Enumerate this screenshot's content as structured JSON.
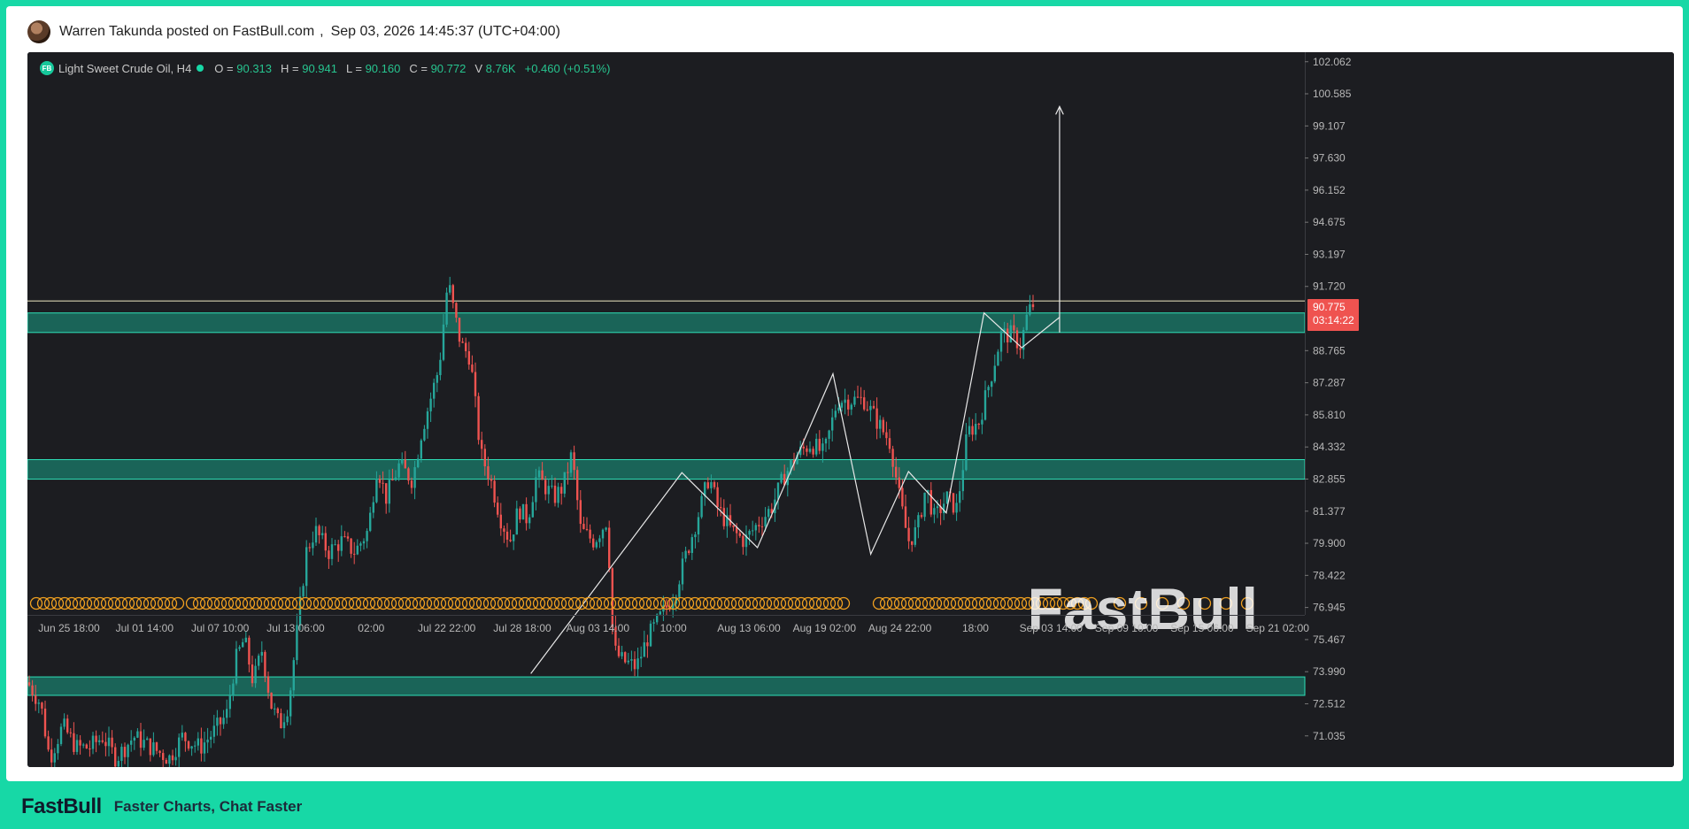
{
  "post": {
    "author": "Warren Takunda",
    "text": "Warren Takunda posted on FastBull.com",
    "separator": ",",
    "timestamp": "Sep 03, 2026 14:45:37 (UTC+04:00)"
  },
  "legend": {
    "badge": "FB",
    "symbol": "Light Sweet Crude Oil, H4",
    "o_label": "O =",
    "o_value": "90.313",
    "h_label": "H =",
    "h_value": "90.941",
    "l_label": "L =",
    "l_value": "90.160",
    "c_label": "C =",
    "c_value": "90.772",
    "v_label": "V",
    "v_value": "8.76K",
    "change": "+0.460 (+0.51%)"
  },
  "price_tag": {
    "price": "90.775",
    "countdown": "03:14:22"
  },
  "watermark": "FastBull",
  "footer": {
    "logo": "FastBull",
    "tagline": "Faster Charts, Chat Faster"
  },
  "colors": {
    "up": "#26a69a",
    "down": "#ef5350",
    "zone": "#1a8f7a",
    "accent": "#17d8a6",
    "price_tag": "#ef5350",
    "marker": "#f0a020"
  },
  "chart_data": {
    "type": "candlestick",
    "title": "Light Sweet Crude Oil, H4",
    "ylim": [
      69.6,
      102.5
    ],
    "y_ticks": [
      "102.062",
      "100.585",
      "99.107",
      "97.630",
      "96.152",
      "94.675",
      "93.197",
      "91.720",
      "88.765",
      "87.287",
      "85.810",
      "84.332",
      "82.855",
      "81.377",
      "79.900",
      "78.422",
      "76.945",
      "75.467",
      "73.990",
      "72.512",
      "71.035"
    ],
    "x_ticks": [
      "Jun 25 18:00",
      "Jul 01 14:00",
      "Jul 07 10:00",
      "Jul 13 06:00",
      "02:00",
      "Jul 22 22:00",
      "Jul 28 18:00",
      "Aug 03 14:00",
      "10:00",
      "Aug 13 06:00",
      "Aug 19 02:00",
      "Aug 24 22:00",
      "18:00",
      "Sep 03 14:00",
      "Sep 09 10:00",
      "Sep 15 06:00",
      "Sep 21 02:00"
    ],
    "zones": [
      [
        89.6,
        90.5
      ],
      [
        82.85,
        83.75
      ],
      [
        72.9,
        73.75
      ]
    ],
    "horizontal_line": 91.05,
    "path_points": [
      [
        "Jul 28 18:00+",
        73.9
      ],
      [
        "Aug 13 06:00-",
        83.15
      ],
      [
        "Aug 13 06:00+",
        79.7
      ],
      [
        "Aug 19 02:00+",
        87.7
      ],
      [
        "Aug 24 22:00",
        79.4
      ],
      [
        "Aug 24 22:00+",
        83.2
      ],
      [
        "18:00",
        81.3
      ],
      [
        "18:00+",
        90.5
      ],
      [
        "Sep 03 14:00",
        88.9
      ],
      [
        "Sep 03 14:00+",
        90.3
      ]
    ],
    "projection": [
      [
        "Sep 03 14:00+",
        89.6
      ],
      [
        "Sep 09 10:00-",
        100.0
      ]
    ],
    "price_path": [
      [
        0,
        73.5
      ],
      [
        15,
        72.5
      ],
      [
        25,
        70.0
      ],
      [
        40,
        71.5
      ],
      [
        55,
        70.5
      ],
      [
        70,
        70.5
      ],
      [
        85,
        71.0
      ],
      [
        100,
        70.0
      ],
      [
        120,
        71.0
      ],
      [
        140,
        70.5
      ],
      [
        160,
        70.0
      ],
      [
        175,
        71.0
      ],
      [
        195,
        70.5
      ],
      [
        210,
        71.2
      ],
      [
        225,
        72.0
      ],
      [
        235,
        74.5
      ],
      [
        245,
        75.5
      ],
      [
        255,
        73.5
      ],
      [
        265,
        75.0
      ],
      [
        275,
        72.5
      ],
      [
        285,
        71.5
      ],
      [
        295,
        72.5
      ],
      [
        305,
        76.0
      ],
      [
        315,
        79.5
      ],
      [
        325,
        80.5
      ],
      [
        340,
        79.5
      ],
      [
        355,
        80.0
      ],
      [
        370,
        79.5
      ],
      [
        385,
        80.5
      ],
      [
        395,
        83.5
      ],
      [
        405,
        82.0
      ],
      [
        420,
        83.5
      ],
      [
        435,
        82.8
      ],
      [
        445,
        85.0
      ],
      [
        455,
        86.5
      ],
      [
        465,
        88.0
      ],
      [
        475,
        92.0
      ],
      [
        482,
        90.5
      ],
      [
        490,
        89.0
      ],
      [
        500,
        88.5
      ],
      [
        512,
        84.0
      ],
      [
        522,
        83.0
      ],
      [
        535,
        81.0
      ],
      [
        545,
        80.0
      ],
      [
        555,
        81.5
      ],
      [
        565,
        81.0
      ],
      [
        575,
        83.0
      ],
      [
        585,
        82.5
      ],
      [
        595,
        82.0
      ],
      [
        605,
        82.5
      ],
      [
        615,
        84.0
      ],
      [
        625,
        80.5
      ],
      [
        640,
        80.0
      ],
      [
        655,
        81.0
      ],
      [
        662,
        75.0
      ],
      [
        672,
        74.5
      ],
      [
        688,
        74.2
      ],
      [
        700,
        75.5
      ],
      [
        715,
        76.5
      ],
      [
        730,
        77.5
      ],
      [
        745,
        79.5
      ],
      [
        760,
        81.5
      ],
      [
        770,
        83.0
      ],
      [
        780,
        81.5
      ],
      [
        795,
        80.5
      ],
      [
        810,
        80.0
      ],
      [
        825,
        80.8
      ],
      [
        840,
        81.5
      ],
      [
        855,
        83.0
      ],
      [
        870,
        84.0
      ],
      [
        885,
        84.5
      ],
      [
        900,
        84.0
      ],
      [
        915,
        86.5
      ],
      [
        930,
        86.5
      ],
      [
        945,
        86.5
      ],
      [
        960,
        85.5
      ],
      [
        975,
        84.5
      ],
      [
        985,
        82.0
      ],
      [
        995,
        80.0
      ],
      [
        1005,
        80.5
      ],
      [
        1015,
        82.5
      ],
      [
        1025,
        81.0
      ],
      [
        1038,
        82.0
      ],
      [
        1050,
        81.5
      ],
      [
        1062,
        85.0
      ],
      [
        1075,
        85.5
      ],
      [
        1088,
        87.5
      ],
      [
        1100,
        89.5
      ],
      [
        1112,
        89.5
      ],
      [
        1122,
        89.0
      ],
      [
        1130,
        90.5
      ],
      [
        1138,
        91.0
      ]
    ]
  }
}
